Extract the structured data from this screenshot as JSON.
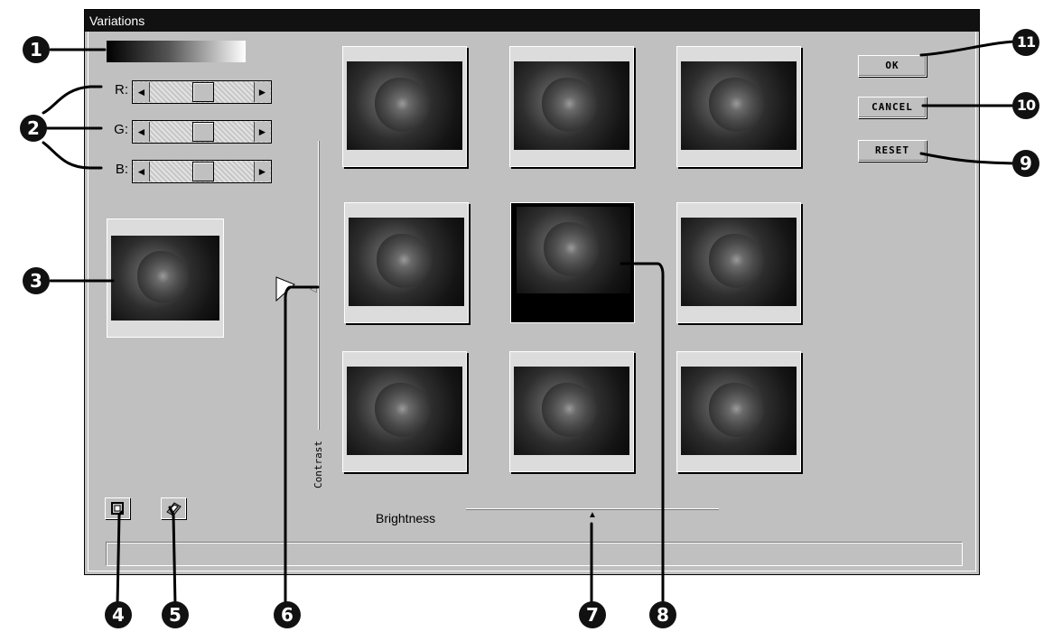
{
  "window": {
    "title": "Variations"
  },
  "channels": [
    {
      "label": "R:",
      "value_fraction": 0.5
    },
    {
      "label": "G:",
      "value_fraction": 0.5
    },
    {
      "label": "B:",
      "value_fraction": 0.5
    }
  ],
  "slider_arrows": {
    "left": "◄",
    "right": "►"
  },
  "contrast": {
    "label": "Contrast"
  },
  "brightness": {
    "label": "Brightness"
  },
  "buttons": {
    "ok": "OK",
    "cancel": "CANCEL",
    "reset": "RESET"
  },
  "variation_grid": {
    "rows": 3,
    "columns": 3,
    "selected_index": 4
  },
  "tool_icons": [
    "window-icon",
    "eraser-icon"
  ],
  "callouts": [
    "1",
    "2",
    "3",
    "4",
    "5",
    "6",
    "7",
    "8",
    "9",
    "10",
    "11"
  ],
  "colors": {
    "dialog_bg": "#c0c0c0",
    "title_bg": "#111111",
    "callout": "#111111"
  }
}
